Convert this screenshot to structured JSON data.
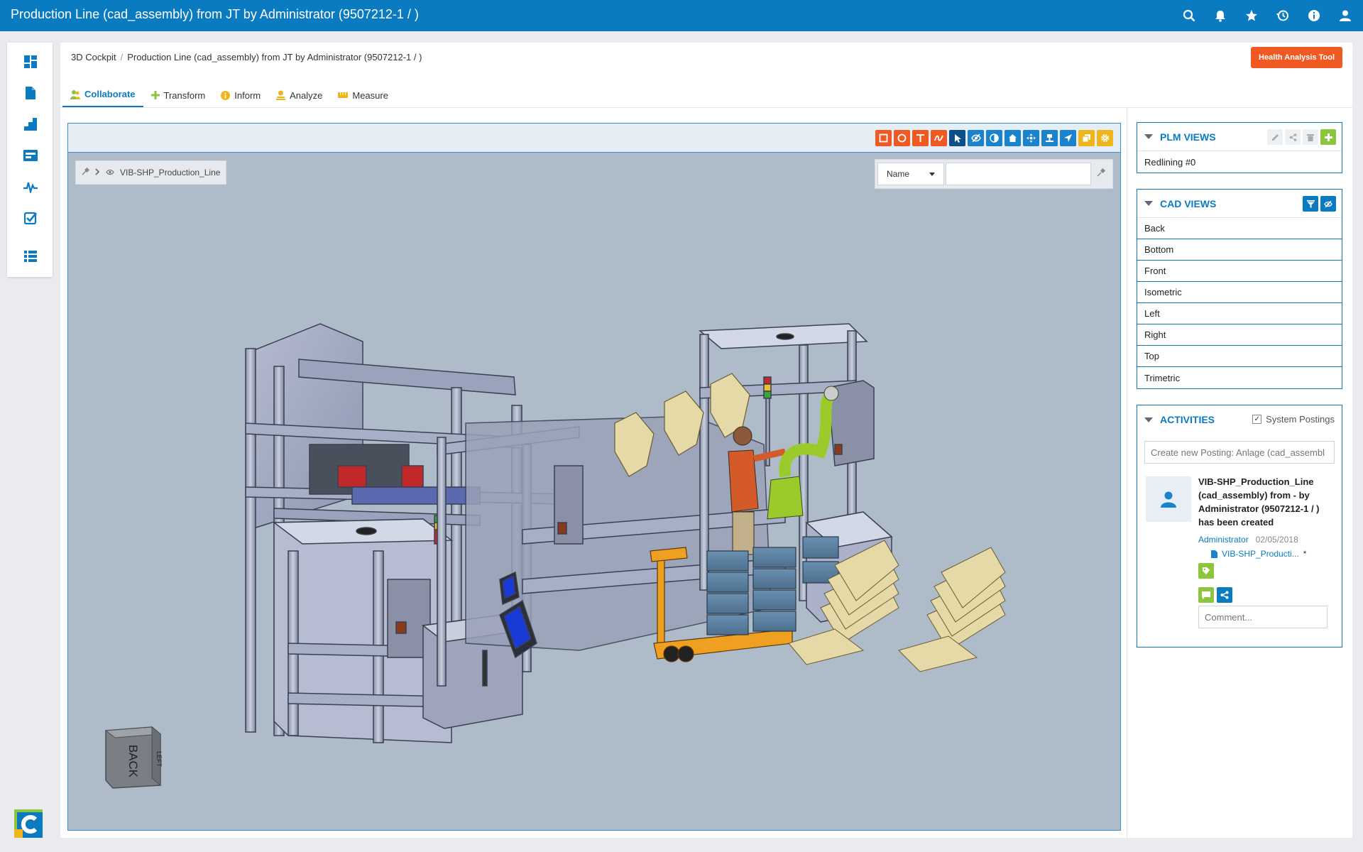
{
  "app": {
    "title": "Production Line (cad_assembly) from JT by Administrator (9507212-1 / )"
  },
  "topbar_icons": [
    "search-icon",
    "bell-icon",
    "star-icon",
    "history-icon",
    "info-icon",
    "user-icon"
  ],
  "left_nav": [
    "dashboard-icon",
    "document-icon",
    "stairs-icon",
    "card-icon",
    "pulse-icon",
    "checkbox-icon",
    "list-icon"
  ],
  "breadcrumb": {
    "root": "3D Cockpit",
    "separator": "/",
    "current": "Production Line (cad_assembly) from JT by Administrator (9507212-1 / )"
  },
  "health_button": "Health Analysis Tool",
  "tabs": [
    {
      "label": "Collaborate",
      "icon": "people-icon",
      "active": true
    },
    {
      "label": "Transform",
      "icon": "plus-icon",
      "active": false
    },
    {
      "label": "Inform",
      "icon": "info-icon",
      "active": false
    },
    {
      "label": "Analyze",
      "icon": "analyze-icon",
      "active": false
    },
    {
      "label": "Measure",
      "icon": "ruler-icon",
      "active": false
    }
  ],
  "viewer": {
    "scene_path": "VIB-SHP_Production_Line",
    "search_field": "Name",
    "search_value": "",
    "navcube_face": "BACK",
    "navcube_side": "LEFT"
  },
  "plm_views": {
    "title": "PLM VIEWS",
    "items": [
      "Redlining #0"
    ]
  },
  "cad_views": {
    "title": "CAD VIEWS",
    "items": [
      "Back",
      "Bottom",
      "Front",
      "Isometric",
      "Left",
      "Right",
      "Top",
      "Trimetric"
    ]
  },
  "activities": {
    "title": "ACTIVITIES",
    "system_postings_label": "System Postings",
    "system_postings_checked": true,
    "new_post_placeholder": "Create new Posting: Anlage (cad_assembl",
    "post": {
      "text": "VIB-SHP_Production_Line (cad_assembly) from - by Administrator (9507212-1 / ) has been created",
      "author": "Administrator",
      "date": "02/05/2018",
      "link": "VIB-SHP_Producti...",
      "link_marker": "*"
    },
    "comment_placeholder": "Comment..."
  },
  "colors": {
    "brand_blue": "#0a7bc1",
    "accent_orange": "#f05a22",
    "viewer_bg": "#aebcca",
    "green": "#8cc63f"
  }
}
